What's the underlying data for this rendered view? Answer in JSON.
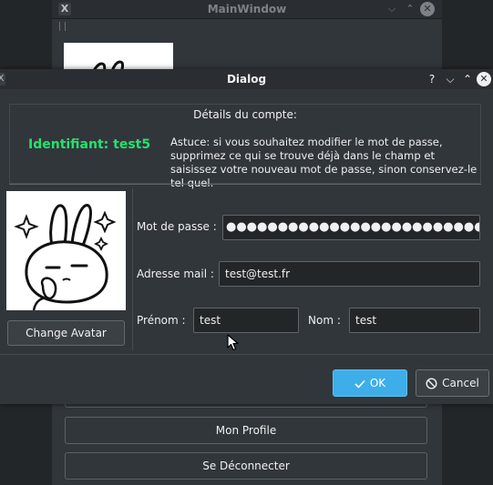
{
  "main_window": {
    "title": "MainWindow",
    "app_icon": "X",
    "buttons": [
      {
        "label": ""
      },
      {
        "label": "Mon Profile"
      },
      {
        "label": "Se Déconnecter"
      }
    ],
    "window_controls": [
      "chevron-down-icon",
      "chevron-up-icon",
      "close-icon"
    ]
  },
  "dialog": {
    "title": "Dialog",
    "help_glyph": "?",
    "section_title": "Détails du compte:",
    "identifier": "Identifiant: test5",
    "identifier_color": "#27e06f",
    "tip": "Astuce: si vous souhaitez modifier le mot de passe, supprimez ce qui se trouve déjà dans le champ et saisissez votre nouveau mot de passe, sinon conservez-le tel quel.",
    "change_avatar": "Change Avatar",
    "form": {
      "password_label": "Mot de passe  :",
      "password_value": "●●●●●●●●●●●●●●●●●●●●●●●●●●●●●",
      "email_label": "Adresse mail :",
      "email_value": "test@test.fr",
      "firstname_label": "Prénom :",
      "firstname_value": "test",
      "lastname_label": "Nom :",
      "lastname_value": "test"
    },
    "ok_label": "OK",
    "cancel_label": "Cancel",
    "accent_color": "#3daee9"
  }
}
